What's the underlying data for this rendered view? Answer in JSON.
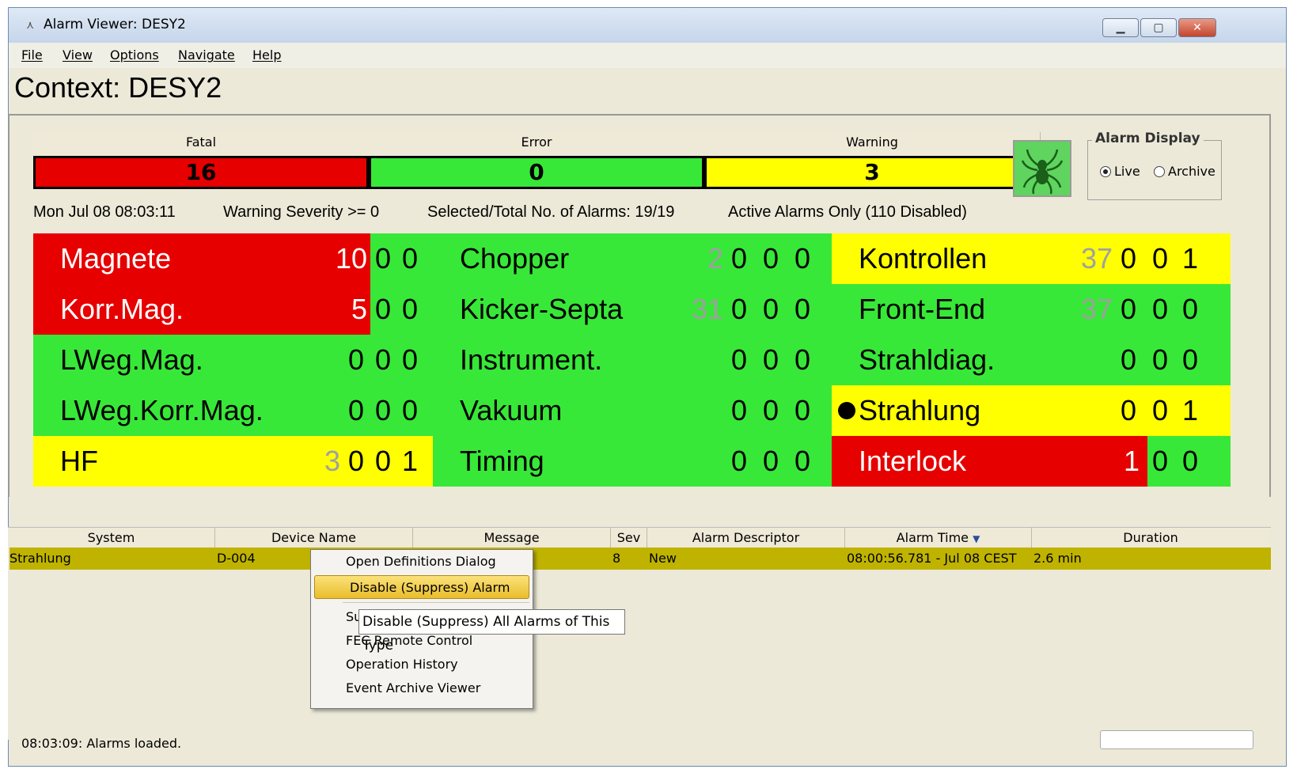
{
  "window": {
    "title": "Alarm Viewer:  DESY2"
  },
  "menu": {
    "file": "File",
    "view": "View",
    "options": "Options",
    "navigate": "Navigate",
    "help": "Help"
  },
  "context_title": "Context: DESY2",
  "severity": {
    "fatal": {
      "label": "Fatal",
      "count": "16",
      "color": "#e60000"
    },
    "error": {
      "label": "Error",
      "count": "0",
      "color": "#38e838"
    },
    "warning": {
      "label": "Warning",
      "count": "3",
      "color": "#ffff00"
    }
  },
  "alarm_display": {
    "legend": "Alarm Display",
    "live": "Live",
    "archive": "Archive",
    "selected": "Live"
  },
  "info": {
    "datetime": "Mon Jul 08 08:03:11",
    "severity_filter": "Warning Severity >= 0",
    "alarm_count": "Selected/Total No. of Alarms: 19/19",
    "active": "Active Alarms Only  (110 Disabled)"
  },
  "colors": {
    "red": "#e60000",
    "green": "#38e838",
    "yellow": "#ffff00",
    "grey_text": "#a0a0a0"
  },
  "groups": [
    [
      {
        "name": "Magnete",
        "count": "10",
        "n": [
          "0",
          "0"
        ],
        "bg": "red"
      },
      {
        "name": "Korr.Mag.",
        "count": "5",
        "n": [
          "0",
          "0"
        ],
        "bg": "red"
      },
      {
        "name": "LWeg.Mag.",
        "count": "",
        "n": [
          "0",
          "0",
          "0"
        ],
        "bg": "green"
      },
      {
        "name": "LWeg.Korr.Mag.",
        "count": "",
        "n": [
          "0",
          "0",
          "0"
        ],
        "bg": "green"
      },
      {
        "name": "HF",
        "count": "3",
        "n": [
          "0",
          "0",
          "1"
        ],
        "bg": "yellow"
      }
    ],
    [
      {
        "name": "Chopper",
        "count": "2",
        "n": [
          "0",
          "0",
          "0"
        ],
        "bg": "green"
      },
      {
        "name": "Kicker-Septa",
        "count": "31",
        "n": [
          "0",
          "0",
          "0"
        ],
        "bg": "green"
      },
      {
        "name": "Instrument.",
        "count": "",
        "n": [
          "0",
          "0",
          "0"
        ],
        "bg": "green"
      },
      {
        "name": "Vakuum",
        "count": "",
        "n": [
          "0",
          "0",
          "0"
        ],
        "bg": "green"
      },
      {
        "name": "Timing",
        "count": "",
        "n": [
          "0",
          "0",
          "0"
        ],
        "bg": "green"
      }
    ],
    [
      {
        "name": "Kontrollen",
        "count": "37",
        "n": [
          "0",
          "0",
          "1"
        ],
        "bg": "yellow"
      },
      {
        "name": "Front-End",
        "count": "37",
        "n": [
          "0",
          "0",
          "0"
        ],
        "bg": "green"
      },
      {
        "name": "Strahldiag.",
        "count": "",
        "n": [
          "0",
          "0",
          "0"
        ],
        "bg": "green"
      },
      {
        "name": "Strahlung",
        "count": "",
        "n": [
          "0",
          "0",
          "1"
        ],
        "bg": "yellow"
      },
      {
        "name": "Interlock",
        "count": "1",
        "n": [
          "0",
          "0"
        ],
        "bg": "red"
      }
    ]
  ],
  "table": {
    "columns": [
      "System",
      "Device Name",
      "Message",
      "Sev",
      "Alarm Descriptor",
      "Alarm Time",
      "Duration"
    ],
    "row": {
      "system": "Strahlung",
      "device": "D-004",
      "message": "",
      "sev": "8",
      "descriptor": "New",
      "time": "08:00:56.781 - Jul 08 CEST",
      "duration": "2.6 min"
    }
  },
  "context_menu": {
    "items": [
      "Open Definitions Dialog",
      "Disable (Suppress) Alarm",
      "Su",
      "FEC Remote Control",
      "Operation History",
      "Event Archive Viewer"
    ],
    "tooltip": "Disable (Suppress) All Alarms of This Type"
  },
  "status": {
    "text": "08:03:09: Alarms loaded."
  }
}
